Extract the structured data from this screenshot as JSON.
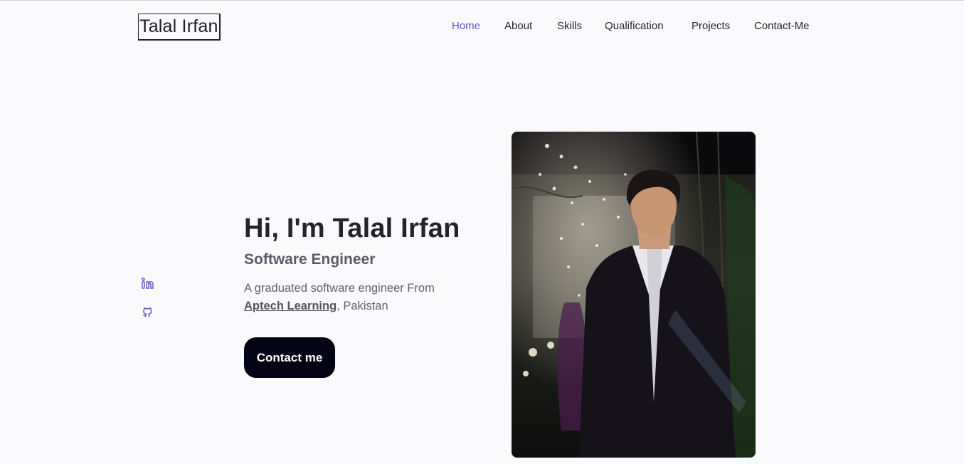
{
  "header": {
    "logo": "Talal Irfan",
    "nav": [
      {
        "label": "Home",
        "active": true
      },
      {
        "label": "About",
        "active": false
      },
      {
        "label": "Skills",
        "active": false
      },
      {
        "label": "Qualification",
        "active": false
      },
      {
        "label": "Projects",
        "active": false
      },
      {
        "label": "Contact-Me",
        "active": false
      }
    ]
  },
  "social": [
    {
      "icon": "linkedin-icon"
    },
    {
      "icon": "github-icon"
    }
  ],
  "hero": {
    "title": "Hi, I'm Talal Irfan",
    "subtitle": "Software Engineer",
    "description_prefix": "A graduated software engineer From",
    "school": "Aptech Learning",
    "description_suffix": ", Pakistan",
    "cta_label": "Contact me"
  },
  "colors": {
    "accent": "#5b55c8",
    "button_bg": "#050416",
    "page_bg": "#fafafc"
  }
}
